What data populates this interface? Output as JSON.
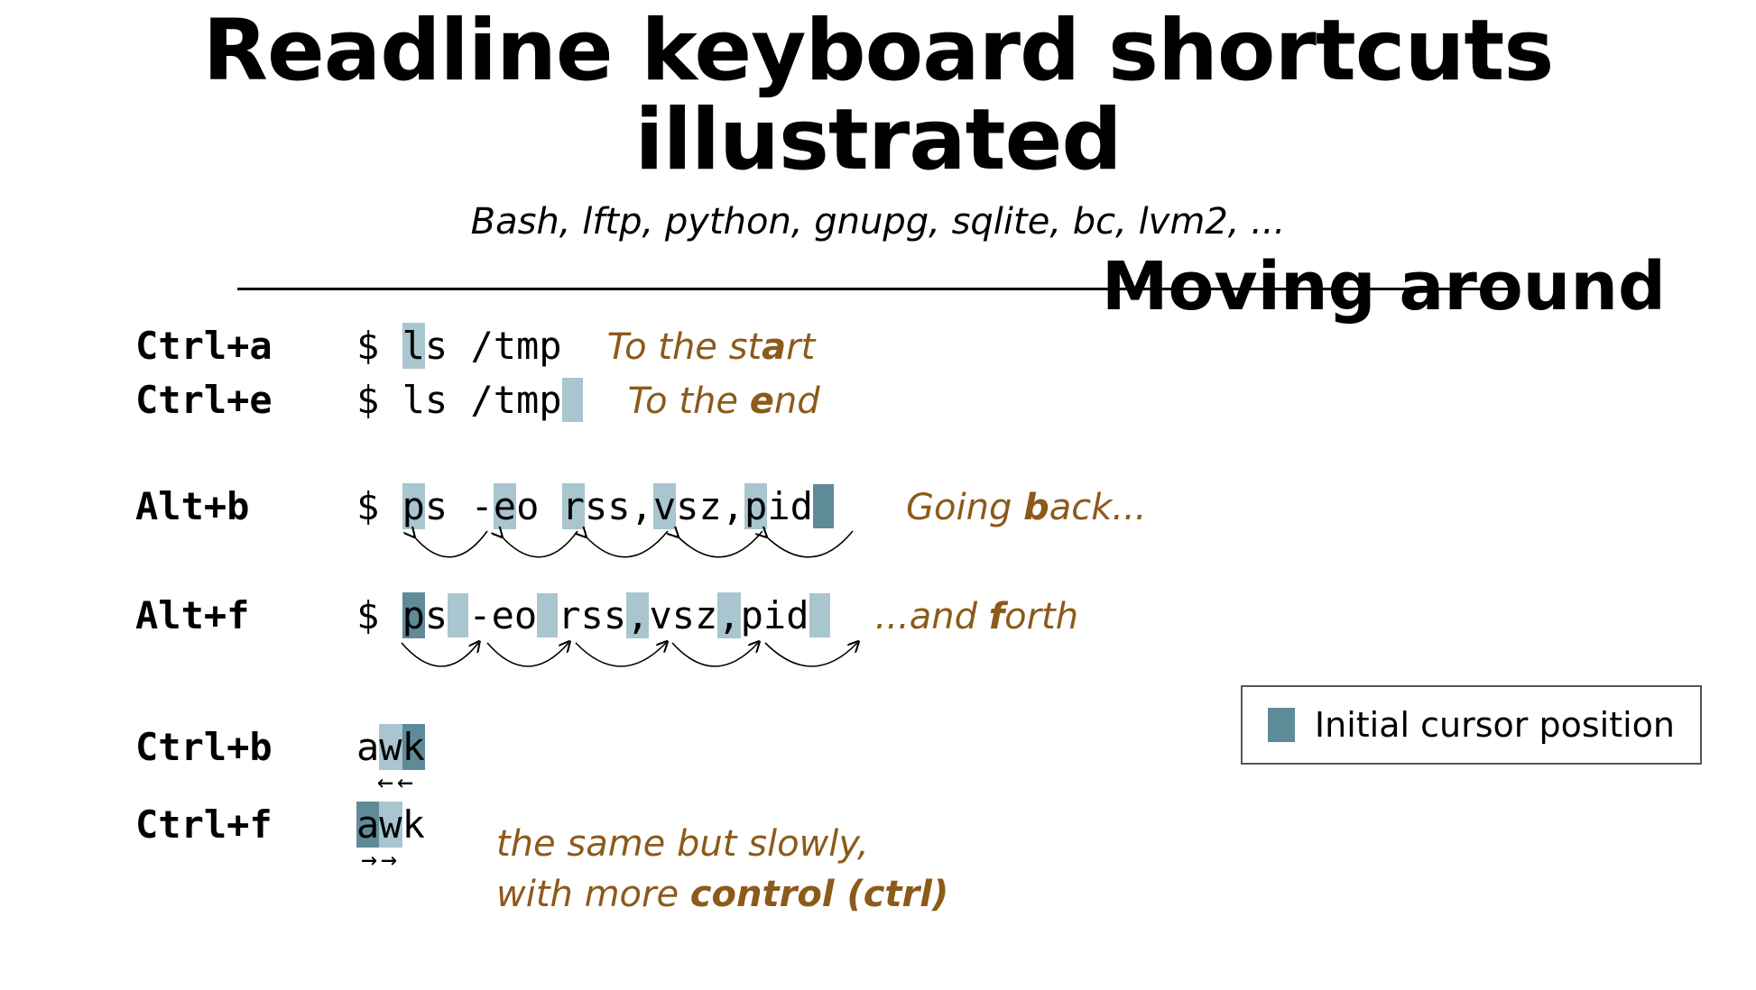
{
  "title": "Readline keyboard shortcuts illustrated",
  "subtitle": "Bash, lftp, python, gnupg, sqlite, bc, lvm2, ...",
  "section": "Moving around",
  "legend": "Initial cursor position",
  "rows": {
    "ctrl_a": {
      "key": "Ctrl+a",
      "prefix": "$ ",
      "hl": "l",
      "rest": "s /tmp",
      "note_pre": "To the st",
      "note_bold": "a",
      "note_post": "rt"
    },
    "ctrl_e": {
      "key": "Ctrl+e",
      "prefix": "$ ls /tmp",
      "note_pre": "To the ",
      "note_bold": "e",
      "note_post": "nd"
    },
    "alt_b": {
      "key": "Alt+b",
      "prefix": "$ ",
      "note_pre": "Going ",
      "note_bold": "b",
      "note_post": "ack..."
    },
    "alt_f": {
      "key": "Alt+f",
      "prefix": "$ ",
      "note_pre": "...and ",
      "note_bold": "f",
      "note_post": "orth"
    },
    "ctrl_b": {
      "key": "Ctrl+b",
      "pre": "a",
      "hl": "w",
      "dark": "k"
    },
    "ctrl_f": {
      "key": "Ctrl+f",
      "dark": "a",
      "hl": "w",
      "post": "k"
    },
    "slow_note_l1": "the same but slowly,",
    "slow_note_l2_pre": "with more ",
    "slow_note_l2_bold": "control (ctrl)"
  },
  "seg": {
    "p": "p",
    "s": "s",
    "sp": " ",
    "dash": "-",
    "e": "e",
    "o": "o",
    "r": "r",
    "comma": ",",
    "v": "v",
    "z": "z",
    "i": "i",
    "d": "d"
  }
}
